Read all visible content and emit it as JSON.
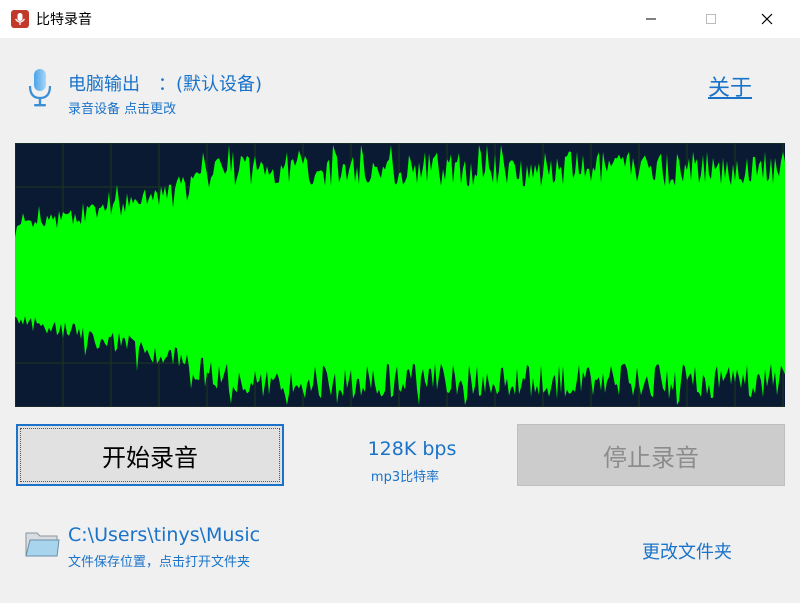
{
  "window": {
    "title": "比特录音",
    "icon": "microphone-app-icon"
  },
  "controls": {
    "minimize": "minimize-icon",
    "maximize": "maximize-icon",
    "close": "close-icon"
  },
  "device": {
    "name": "电脑输出　：(默认设备)",
    "hint": "录音设备  点击更改",
    "icon": "microphone-icon"
  },
  "about": "关于",
  "waveform": {
    "background": "#0a1a33",
    "grid": "#1c3a1c",
    "color": "#00ff00"
  },
  "actions": {
    "start": "开始录音",
    "stop": "停止录音",
    "stop_enabled": false
  },
  "bitrate": {
    "value": "128K bps",
    "label": "mp3比特率"
  },
  "folder": {
    "path": "C:\\Users\\tinys\\Music",
    "hint": "文件保存位置，点击打开文件夹",
    "change": "更改文件夹",
    "icon": "folder-icon"
  },
  "colors": {
    "accent": "#1a73c9",
    "window_bg": "#f0f0f0"
  }
}
